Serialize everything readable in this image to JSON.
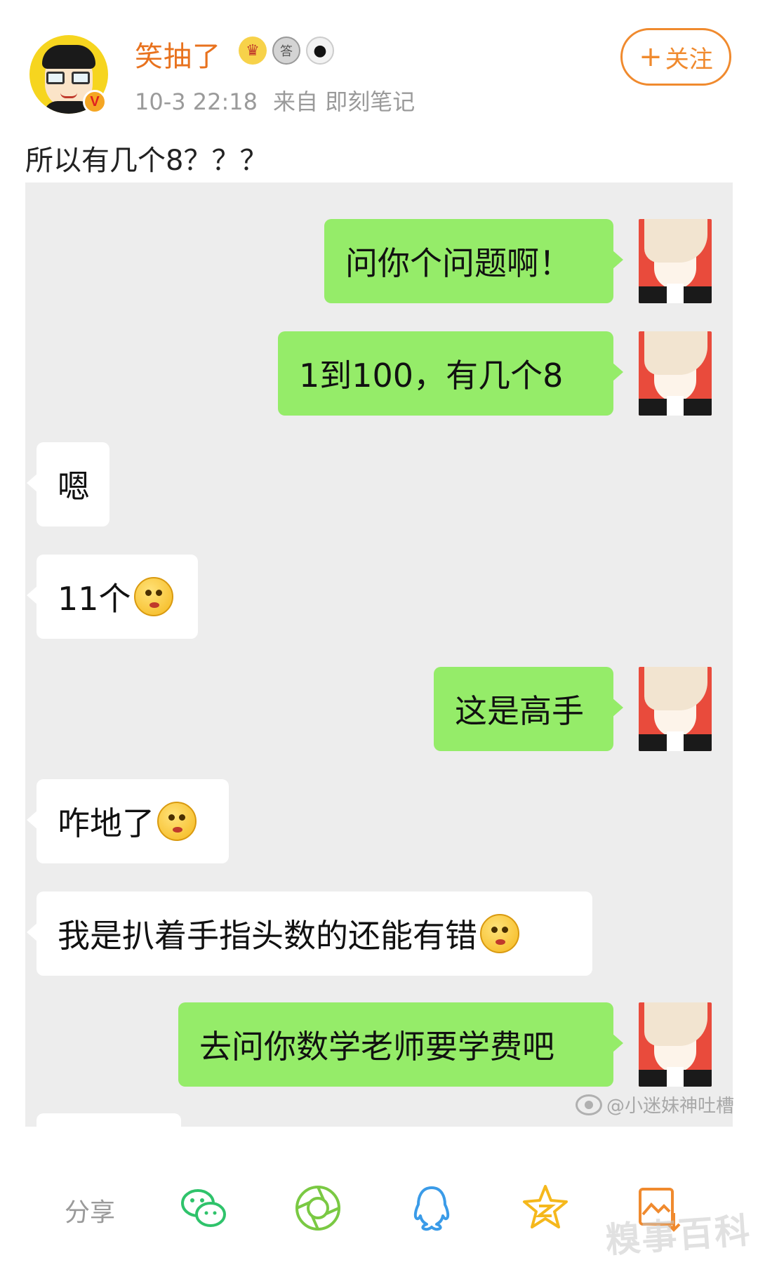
{
  "post": {
    "username": "笑抽了",
    "meta_time": "10-3 22:18",
    "meta_source": "来自 即刻笔记",
    "follow_label": "关注",
    "follow_plus": "+",
    "text": "所以有几个8？？？",
    "medals": [
      "crown-medal-icon",
      "silver-medal-icon",
      "panda-medal-icon"
    ]
  },
  "chat": {
    "messages": [
      {
        "side": "out",
        "text": "问你个问题啊！"
      },
      {
        "side": "out",
        "text": "1到100，有几个8"
      },
      {
        "side": "in",
        "text": "嗯"
      },
      {
        "side": "in",
        "text": "11个"
      },
      {
        "side": "out",
        "text": "这是高手"
      },
      {
        "side": "in",
        "text": "咋地了"
      },
      {
        "side": "in",
        "text": "我是扒着手指头数的还能有错"
      },
      {
        "side": "out",
        "text": "去问你数学老师要学费吧"
      }
    ],
    "watermark": "@小迷妹神吐槽"
  },
  "share": {
    "label": "分享",
    "icons": [
      "wechat-icon",
      "moments-icon",
      "qq-icon",
      "qzone-icon",
      "save-image-icon"
    ],
    "colors": {
      "wechat": "#2fc36b",
      "moments": "#7ac943",
      "qq": "#3a9be8",
      "qzone": "#f5b81c",
      "save": "#f08a2e"
    }
  },
  "corner_watermark": "糗事百科"
}
